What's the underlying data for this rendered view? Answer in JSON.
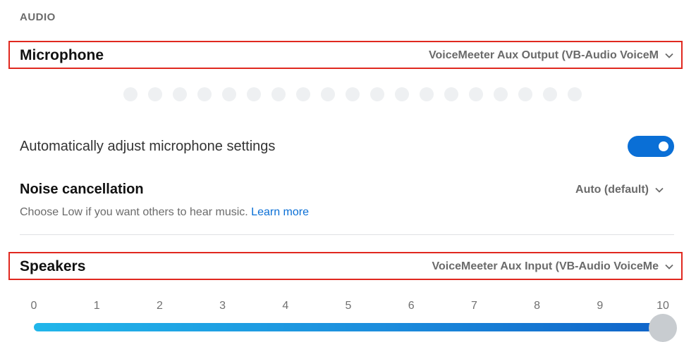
{
  "section": {
    "title": "AUDIO"
  },
  "microphone": {
    "label": "Microphone",
    "device": "VoiceMeeter Aux Output (VB-Audio VoiceM"
  },
  "mic_level": {
    "dots": 19,
    "active": 0
  },
  "auto_adjust": {
    "label": "Automatically adjust microphone settings",
    "enabled": true
  },
  "noise_cancellation": {
    "label": "Noise cancellation",
    "value": "Auto (default)",
    "description": "Choose Low if you want others to hear music.",
    "link": "Learn more"
  },
  "speakers": {
    "label": "Speakers",
    "device": "VoiceMeeter Aux Input (VB-Audio VoiceMe"
  },
  "speaker_volume": {
    "ticks": [
      "0",
      "1",
      "2",
      "3",
      "4",
      "5",
      "6",
      "7",
      "8",
      "9",
      "10"
    ],
    "value": 10
  },
  "colors": {
    "accent": "#0a6fd6",
    "highlight_border": "#e0281f"
  }
}
